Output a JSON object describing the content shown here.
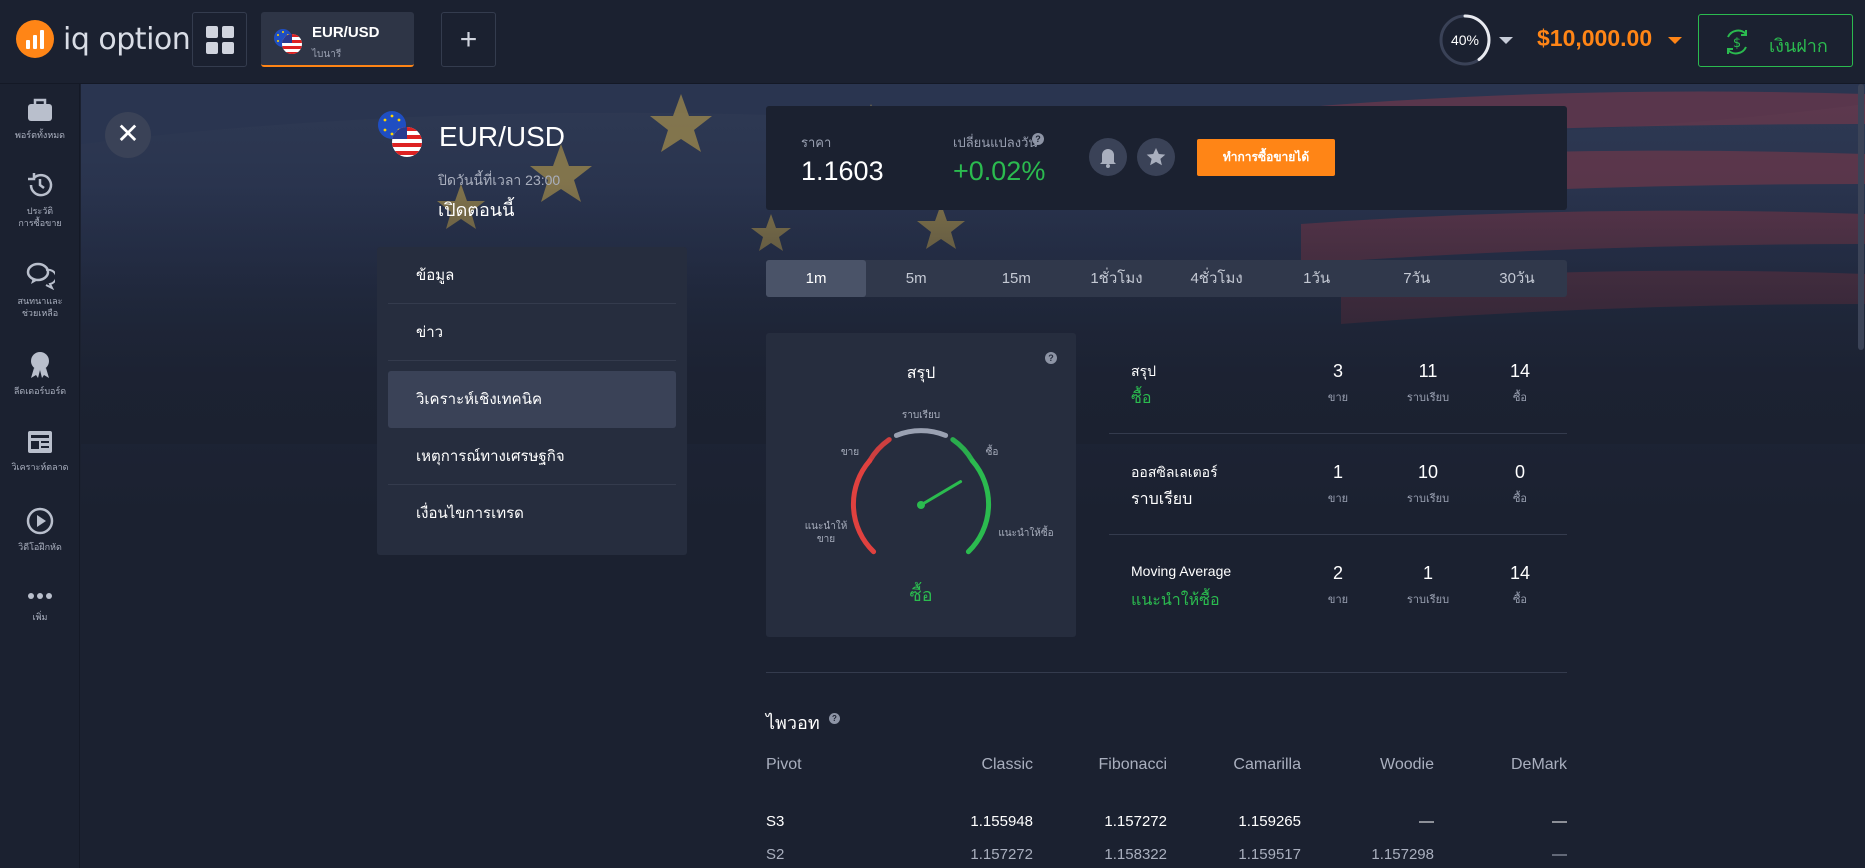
{
  "header": {
    "logo_text": "iq option",
    "asset_tab": {
      "name": "EUR/USD",
      "sub": "ไบนารี"
    },
    "add_label": "+",
    "progress": {
      "value": 40,
      "label": "40%"
    },
    "balance": "$10,000.00",
    "deposit_label": "เงินฝาก",
    "colors": {
      "accent": "#ff8516",
      "green": "#2bbb4f"
    }
  },
  "sidebar": {
    "items": [
      {
        "label": "พอร์ตทั้งหมด",
        "icon": "briefcase-icon"
      },
      {
        "label": "ประวัติ\nการซื้อขาย",
        "icon": "history-icon"
      },
      {
        "label": "สนทนาและ\nช่วยเหลือ",
        "icon": "chat-icon"
      },
      {
        "label": "ลีดเดอร์บอร์ด",
        "icon": "award-icon"
      },
      {
        "label": "วิเคราะห์ตลาด",
        "icon": "news-icon"
      },
      {
        "label": "วิดีโอฝึกหัด",
        "icon": "play-icon"
      },
      {
        "label": "เพิ่ม",
        "icon": "more-icon"
      }
    ]
  },
  "asset": {
    "title": "EUR/USD",
    "close_time": "ปิดวันนี้ที่เวลา 23:00",
    "status": "เปิดตอนนี้"
  },
  "menu": {
    "items": [
      "ข้อมูล",
      "ข่าว",
      "วิเคราะห์เชิงเทคนิค",
      "เหตุการณ์ทางเศรษฐกิจ",
      "เงื่อนไขการเทรด"
    ],
    "active_index": 2
  },
  "price_panel": {
    "price_label": "ราคา",
    "price": "1.1603",
    "change_label": "เปลี่ยนแปลงวัน",
    "change": "+0.02%",
    "trade_label": "ทำการซื้อขายได้"
  },
  "timeframes": {
    "items": [
      "1m",
      "5m",
      "15m",
      "1ชั่วโมง",
      "4ชั่วโมง",
      "1วัน",
      "7วัน",
      "30วัน"
    ],
    "active_index": 0
  },
  "gauge": {
    "title": "สรุป",
    "labels": {
      "neutral": "ราบเรียบ",
      "sell": "ขาย",
      "buy": "ซื้อ",
      "strong_sell": "แนะนำให้\nขาย",
      "strong_buy": "แนะนำให้ซื้อ"
    },
    "needle_value": 0.72,
    "result": "ซื้อ"
  },
  "stats": {
    "captions": {
      "sell": "ขาย",
      "neutral": "ราบเรียบ",
      "buy": "ซื้อ"
    },
    "rows": [
      {
        "name": "สรุป",
        "verdict": "ซื้อ",
        "verdict_type": "buy",
        "sell": "3",
        "neutral": "11",
        "buy": "14"
      },
      {
        "name": "ออสซิลเลเตอร์",
        "verdict": "ราบเรียบ",
        "verdict_type": "neutral",
        "sell": "1",
        "neutral": "10",
        "buy": "0"
      },
      {
        "name": "Moving Average",
        "verdict": "แนะนำให้ซื้อ",
        "verdict_type": "buy",
        "sell": "2",
        "neutral": "1",
        "buy": "14"
      }
    ]
  },
  "pivot": {
    "title": "ไพวอท",
    "headers": [
      "Pivot",
      "Classic",
      "Fibonacci",
      "Camarilla",
      "Woodie",
      "DeMark"
    ],
    "rows": [
      [
        "S3",
        "1.155948",
        "1.157272",
        "1.159265",
        "—",
        "—"
      ],
      [
        "S2",
        "1.157272",
        "1.158322",
        "1.159517",
        "1.157298",
        "—"
      ]
    ]
  }
}
